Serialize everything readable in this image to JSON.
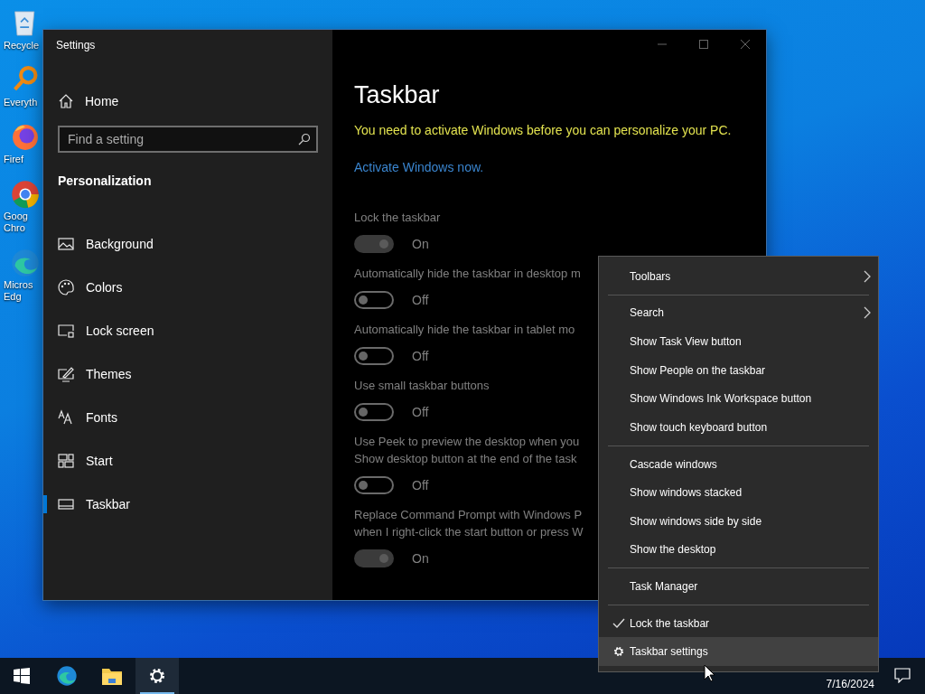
{
  "desktop_icons": [
    {
      "label": "Recycle"
    },
    {
      "label": "Everyth"
    },
    {
      "label": "Firef"
    },
    {
      "label": "Goog\nChro"
    },
    {
      "label": "Micros\nEdg"
    }
  ],
  "window": {
    "title": "Settings"
  },
  "sidebar": {
    "home": "Home",
    "search": {
      "placeholder": "Find a setting"
    },
    "section": "Personalization",
    "items": [
      {
        "label": "Background",
        "selected": false
      },
      {
        "label": "Colors",
        "selected": false
      },
      {
        "label": "Lock screen",
        "selected": false
      },
      {
        "label": "Themes",
        "selected": false
      },
      {
        "label": "Fonts",
        "selected": false
      },
      {
        "label": "Start",
        "selected": false
      },
      {
        "label": "Taskbar",
        "selected": true
      }
    ]
  },
  "page": {
    "title": "Taskbar",
    "warning": "You need to activate Windows before you can personalize your PC.",
    "link": "Activate Windows now.",
    "settings": [
      {
        "lines": [
          "Lock the taskbar"
        ],
        "on": true,
        "disabled": true,
        "status": "On"
      },
      {
        "lines": [
          "Automatically hide the taskbar in desktop m"
        ],
        "on": false,
        "disabled": true,
        "status": "Off"
      },
      {
        "lines": [
          "Automatically hide the taskbar in tablet mo"
        ],
        "on": false,
        "disabled": true,
        "status": "Off"
      },
      {
        "lines": [
          "Use small taskbar buttons"
        ],
        "on": false,
        "disabled": true,
        "status": "Off"
      },
      {
        "lines": [
          "Use Peek to preview the desktop when you",
          "Show desktop button at the end of the task"
        ],
        "on": false,
        "disabled": true,
        "status": "Off"
      },
      {
        "lines": [
          "Replace Command Prompt with Windows P",
          "when I right-click the start button or press W"
        ],
        "on": true,
        "disabled": true,
        "status": "On"
      }
    ]
  },
  "context_menu": [
    {
      "kind": "submenu",
      "label": "Toolbars",
      "checked": false,
      "selected": false
    },
    {
      "kind": "separator"
    },
    {
      "kind": "submenu",
      "label": "Search",
      "checked": false,
      "selected": false
    },
    {
      "kind": "item",
      "label": "Show Task View button",
      "checked": false,
      "selected": false
    },
    {
      "kind": "item",
      "label": "Show People on the taskbar",
      "checked": false,
      "selected": false
    },
    {
      "kind": "item",
      "label": "Show Windows Ink Workspace button",
      "checked": false,
      "selected": false
    },
    {
      "kind": "item",
      "label": "Show touch keyboard button",
      "checked": false,
      "selected": false
    },
    {
      "kind": "separator"
    },
    {
      "kind": "item",
      "label": "Cascade windows",
      "checked": false,
      "selected": false
    },
    {
      "kind": "item",
      "label": "Show windows stacked",
      "checked": false,
      "selected": false
    },
    {
      "kind": "item",
      "label": "Show windows side by side",
      "checked": false,
      "selected": false
    },
    {
      "kind": "item",
      "label": "Show the desktop",
      "checked": false,
      "selected": false
    },
    {
      "kind": "separator"
    },
    {
      "kind": "item",
      "label": "Task Manager",
      "checked": false,
      "selected": false
    },
    {
      "kind": "separator"
    },
    {
      "kind": "item",
      "label": "Lock the taskbar",
      "checked": true,
      "selected": false
    },
    {
      "kind": "settings",
      "label": "Taskbar settings",
      "checked": false,
      "selected": true
    }
  ],
  "taskbar": {
    "apps": [
      {
        "selected": false
      },
      {
        "selected": false
      },
      {
        "selected": true
      }
    ],
    "date": "7/16/2024"
  }
}
